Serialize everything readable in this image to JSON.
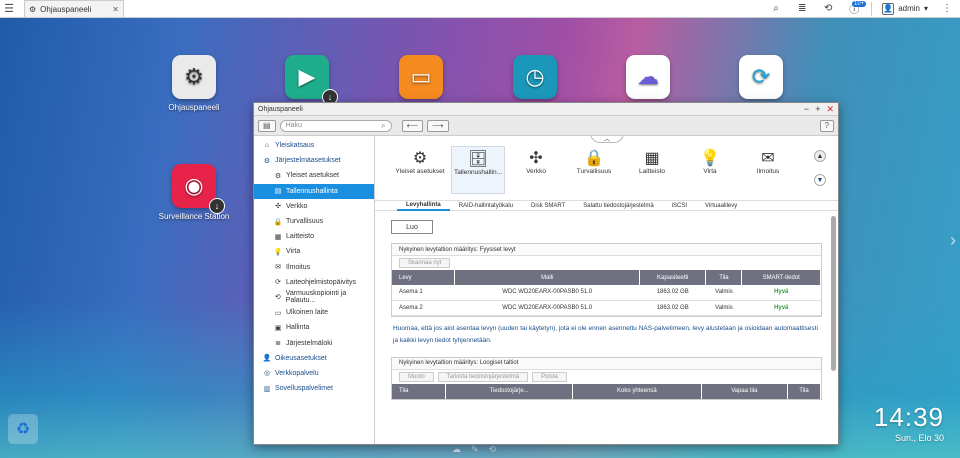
{
  "taskbar": {
    "tab_label": "Ohjauspaneeli",
    "user": "admin",
    "badge": "10+"
  },
  "desktop": {
    "icons": [
      {
        "label": "Ohjauspaneeli",
        "color": "#e8e8e8",
        "glyph": "⚙"
      },
      {
        "label": "",
        "color": "#1fae8c",
        "glyph": "▶"
      },
      {
        "label": "",
        "color": "#f58a1f",
        "glyph": "📁"
      },
      {
        "label": "",
        "color": "#1b97b9",
        "glyph": "◷"
      },
      {
        "label": "",
        "color": "#ffffff",
        "glyph": "☁"
      },
      {
        "label": "",
        "color": "#ffffff",
        "glyph": "⟳"
      },
      {
        "label": "Surveillance Station",
        "color": "#e8234a",
        "glyph": "◉"
      }
    ],
    "clock_time": "14:39",
    "clock_date": "Sun., Elo 30"
  },
  "window": {
    "title": "Ohjauspaneeli",
    "search_placeholder": "Haku",
    "help": "?",
    "sidebar": [
      {
        "label": "Yleiskatsaus",
        "icon": "home-icon",
        "level": 0
      },
      {
        "label": "Järjestelmäasetukset",
        "icon": "gear-icon",
        "level": 0
      },
      {
        "label": "Yleiset asetukset",
        "icon": "settings-icon",
        "level": 1
      },
      {
        "label": "Tallennushallinta",
        "icon": "storage-icon",
        "level": 1,
        "selected": true
      },
      {
        "label": "Verkko",
        "icon": "network-icon",
        "level": 1
      },
      {
        "label": "Turvallisuus",
        "icon": "lock-icon",
        "level": 1
      },
      {
        "label": "Laitteisto",
        "icon": "hardware-icon",
        "level": 1
      },
      {
        "label": "Virta",
        "icon": "power-icon",
        "level": 1
      },
      {
        "label": "Ilmoitus",
        "icon": "notification-icon",
        "level": 1
      },
      {
        "label": "Laiteohjelmistopäivitys",
        "icon": "firmware-icon",
        "level": 1
      },
      {
        "label": "Varmuuskopiointi ja Palautu...",
        "icon": "backup-icon",
        "level": 1
      },
      {
        "label": "Ulkoinen laite",
        "icon": "external-device-icon",
        "level": 1
      },
      {
        "label": "Hallinta",
        "icon": "monitor-icon",
        "level": 1
      },
      {
        "label": "Järjestelmäloki",
        "icon": "log-icon",
        "level": 1
      },
      {
        "label": "Oikeusasetukset",
        "icon": "user-icon",
        "level": 0
      },
      {
        "label": "Verkkopalvelu",
        "icon": "globe-icon",
        "level": 0
      },
      {
        "label": "Sovelluspalvelimet",
        "icon": "apps-icon",
        "level": 0
      }
    ],
    "top_icons": [
      {
        "label": "Yleiset asetukset",
        "glyph": "⚙"
      },
      {
        "label": "Tallennushallin...",
        "glyph": "🗄",
        "selected": true
      },
      {
        "label": "Verkko",
        "glyph": "✣"
      },
      {
        "label": "Turvallisuus",
        "glyph": "🔒"
      },
      {
        "label": "Laitteisto",
        "glyph": "▦"
      },
      {
        "label": "Virta",
        "glyph": "💡"
      },
      {
        "label": "Ilmoitus",
        "glyph": "✉"
      }
    ],
    "subtabs": [
      "Levyhallinta",
      "RAID-hallintatyökalu",
      "Disk SMART",
      "Salattu tiedostojärjestelmä",
      "iSCSI",
      "Virtuaalilevy"
    ],
    "create_button": "Luo",
    "physical": {
      "title": "Nykyinen levytaltion määritys: Fyysiset levyt",
      "scan_button": "Skannaa nyt",
      "headers": [
        "Levy",
        "Malli",
        "Kapasiteetti",
        "Tila",
        "SMART-tiedot"
      ],
      "rows": [
        [
          "Asema 1",
          "WDC WD20EARX-00PASB0 51.0",
          "1863.02 GB",
          "Valmis",
          "Hyvä"
        ],
        [
          "Asema 2",
          "WDC WD20EARX-00PASB0 51.0",
          "1863.02 GB",
          "Valmis",
          "Hyvä"
        ]
      ]
    },
    "note": "Huomaa, että jos aiot asentaa levyn (uuden tai käytetyn), jota ei ole ennen asennettu NAS-palvelimeen, levy alustetaan ja osioidaan automaattisesti ja kaikki levyn tiedot tyhjennetään.",
    "logical": {
      "title": "Nykyinen levytaltion määritys: Loogiset taltiot",
      "buttons": [
        "Muoto",
        "Tarkista tiedostojärjestelmä",
        "Poista"
      ],
      "headers": [
        "Tila",
        "Tiedostojärje...",
        "Koko yhteensä",
        "Vapaa tila",
        "Tila"
      ]
    }
  }
}
